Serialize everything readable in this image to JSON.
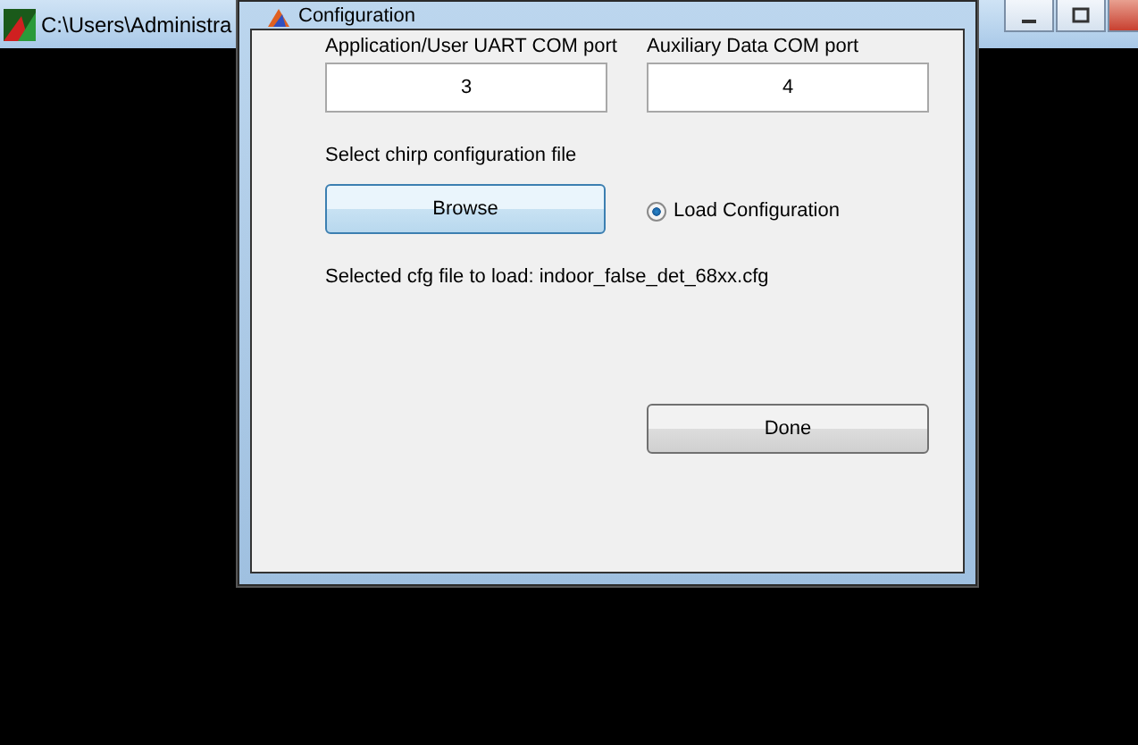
{
  "background_window": {
    "title": "C:\\Users\\Administra"
  },
  "dialog": {
    "title": "Configuration",
    "fields": [
      {
        "label": "Application/User UART COM port",
        "value": "3"
      },
      {
        "label": "Auxiliary Data COM port",
        "value": "4"
      }
    ],
    "file_prompt": "Select chirp configuration file",
    "browse_button": "Browse",
    "load_option": {
      "label": "Load Configuration",
      "selected": true
    },
    "selected_file": "Selected cfg file to load: indoor_false_det_68xx.cfg",
    "done_button": "Done"
  }
}
